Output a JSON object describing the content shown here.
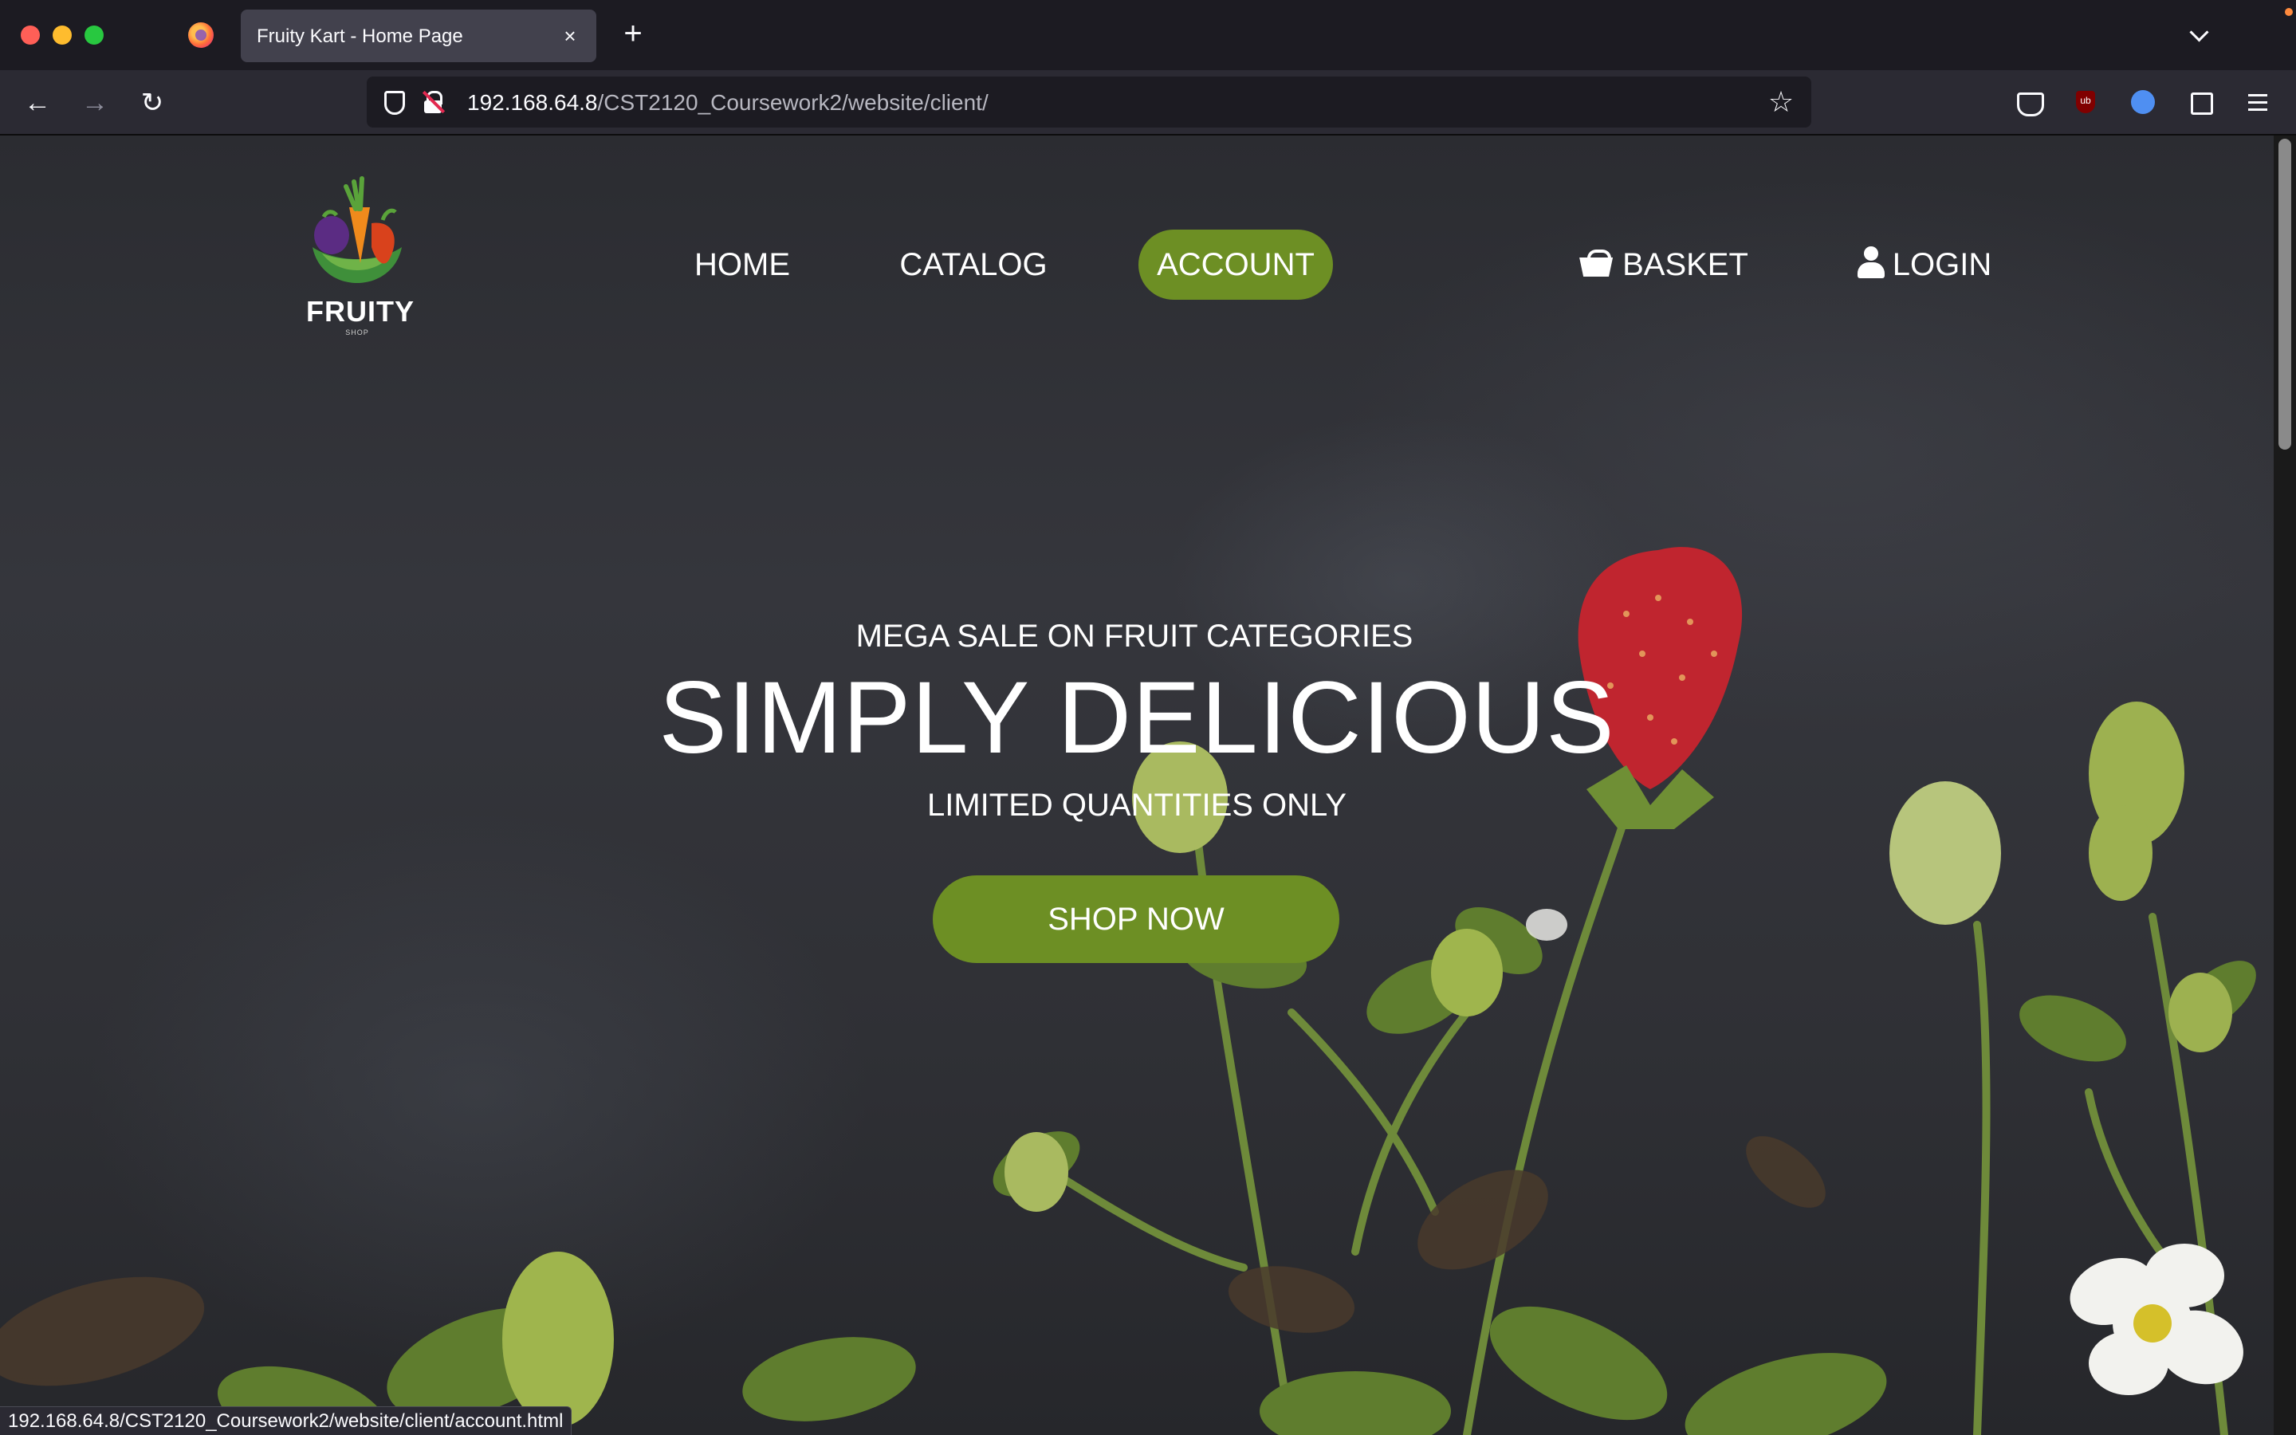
{
  "browser": {
    "tab_title": "Fruity Kart - Home Page",
    "tab_close": "×",
    "new_tab": "+",
    "url_host": "192.168.64.8",
    "url_path": "/CST2120_Coursework2/website/client/",
    "status_url": "192.168.64.8/CST2120_Coursework2/website/client/account.html",
    "icons": [
      "firefox-icon",
      "back-icon",
      "forward-icon",
      "reload-icon",
      "shield-icon",
      "insecure-lock-icon",
      "star-icon",
      "pocket-icon",
      "ublock-icon",
      "extension-icon",
      "puzzle-icon",
      "menu-icon"
    ]
  },
  "site": {
    "logo_text": "FRUITY",
    "logo_sub": "SHOP",
    "nav": {
      "home": "HOME",
      "catalog": "CATALOG",
      "account": "ACCOUNT",
      "basket": "BASKET",
      "login": "LOGIN"
    },
    "hero": {
      "kicker": "MEGA SALE ON FRUIT CATEGORIES",
      "title": "SIMPLY DELICIOUS",
      "subtitle": "LIMITED QUANTITIES ONLY",
      "cta": "SHOP NOW"
    }
  },
  "colors": {
    "accent_green": "#6d8f24",
    "chrome_dark": "#1c1b22",
    "toolbar": "#2b2a33"
  }
}
